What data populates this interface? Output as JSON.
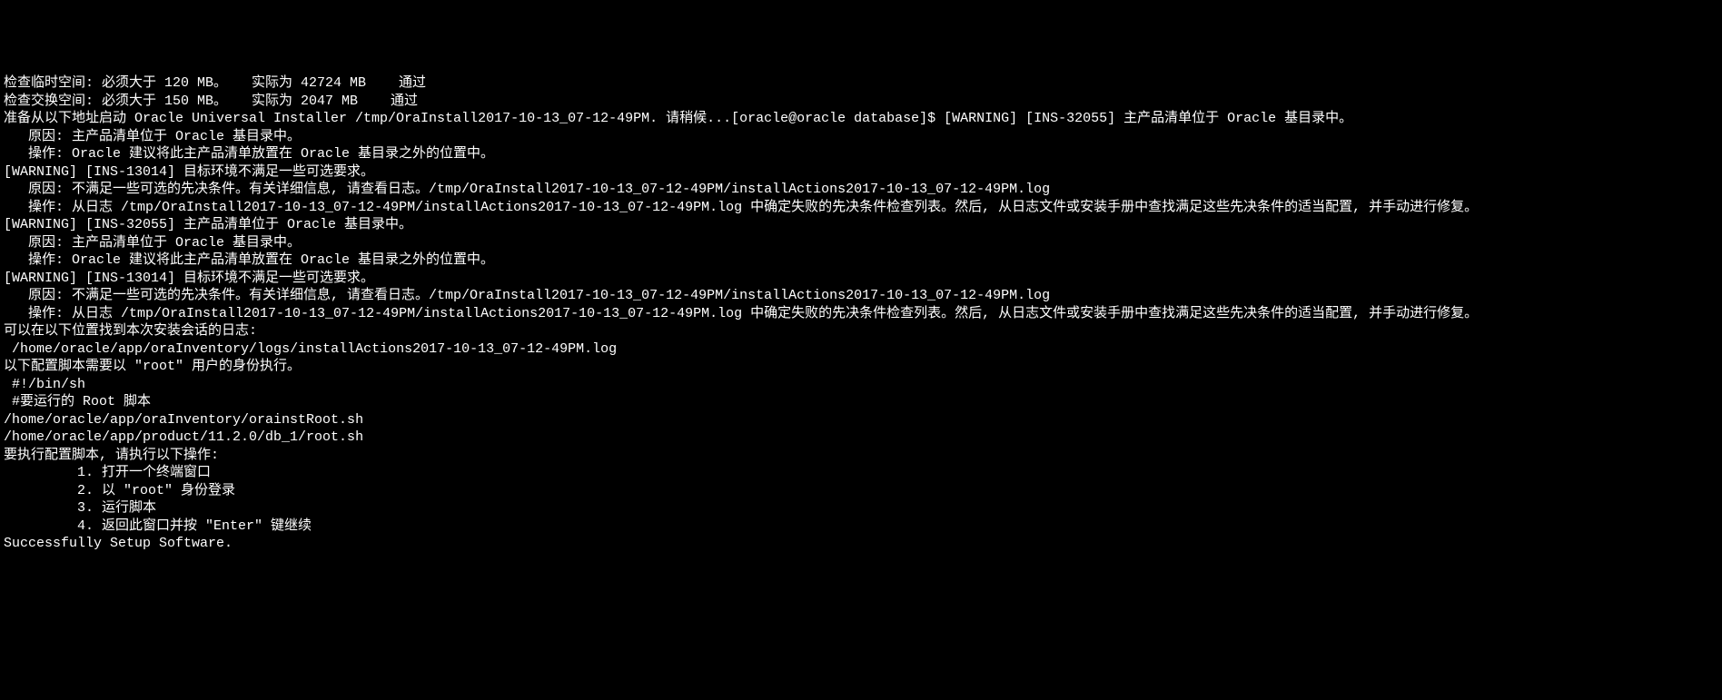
{
  "lines": [
    "检查临时空间: 必须大于 120 MB。   实际为 42724 MB    通过",
    "检查交换空间: 必须大于 150 MB。   实际为 2047 MB    通过",
    "准备从以下地址启动 Oracle Universal Installer /tmp/OraInstall2017-10-13_07-12-49PM. 请稍候...[oracle@oracle database]$ [WARNING] [INS-32055] 主产品清单位于 Oracle 基目录中。",
    "   原因: 主产品清单位于 Oracle 基目录中。",
    "   操作: Oracle 建议将此主产品清单放置在 Oracle 基目录之外的位置中。",
    "[WARNING] [INS-13014] 目标环境不满足一些可选要求。",
    "   原因: 不满足一些可选的先决条件。有关详细信息, 请查看日志。/tmp/OraInstall2017-10-13_07-12-49PM/installActions2017-10-13_07-12-49PM.log",
    "   操作: 从日志 /tmp/OraInstall2017-10-13_07-12-49PM/installActions2017-10-13_07-12-49PM.log 中确定失败的先决条件检查列表。然后, 从日志文件或安装手册中查找满足这些先决条件的适当配置, 并手动进行修复。",
    "[WARNING] [INS-32055] 主产品清单位于 Oracle 基目录中。",
    "   原因: 主产品清单位于 Oracle 基目录中。",
    "   操作: Oracle 建议将此主产品清单放置在 Oracle 基目录之外的位置中。",
    "[WARNING] [INS-13014] 目标环境不满足一些可选要求。",
    "   原因: 不满足一些可选的先决条件。有关详细信息, 请查看日志。/tmp/OraInstall2017-10-13_07-12-49PM/installActions2017-10-13_07-12-49PM.log",
    "   操作: 从日志 /tmp/OraInstall2017-10-13_07-12-49PM/installActions2017-10-13_07-12-49PM.log 中确定失败的先决条件检查列表。然后, 从日志文件或安装手册中查找满足这些先决条件的适当配置, 并手动进行修复。",
    "可以在以下位置找到本次安装会话的日志:",
    " /home/oracle/app/oraInventory/logs/installActions2017-10-13_07-12-49PM.log",
    "以下配置脚本需要以 \"root\" 用户的身份执行。",
    " #!/bin/sh",
    " #要运行的 Root 脚本",
    "",
    "/home/oracle/app/oraInventory/orainstRoot.sh",
    "/home/oracle/app/product/11.2.0/db_1/root.sh",
    "要执行配置脚本, 请执行以下操作:",
    "\t 1. 打开一个终端窗口",
    "\t 2. 以 \"root\" 身份登录",
    "\t 3. 运行脚本",
    "\t 4. 返回此窗口并按 \"Enter\" 键继续",
    "",
    "Successfully Setup Software.",
    ""
  ]
}
